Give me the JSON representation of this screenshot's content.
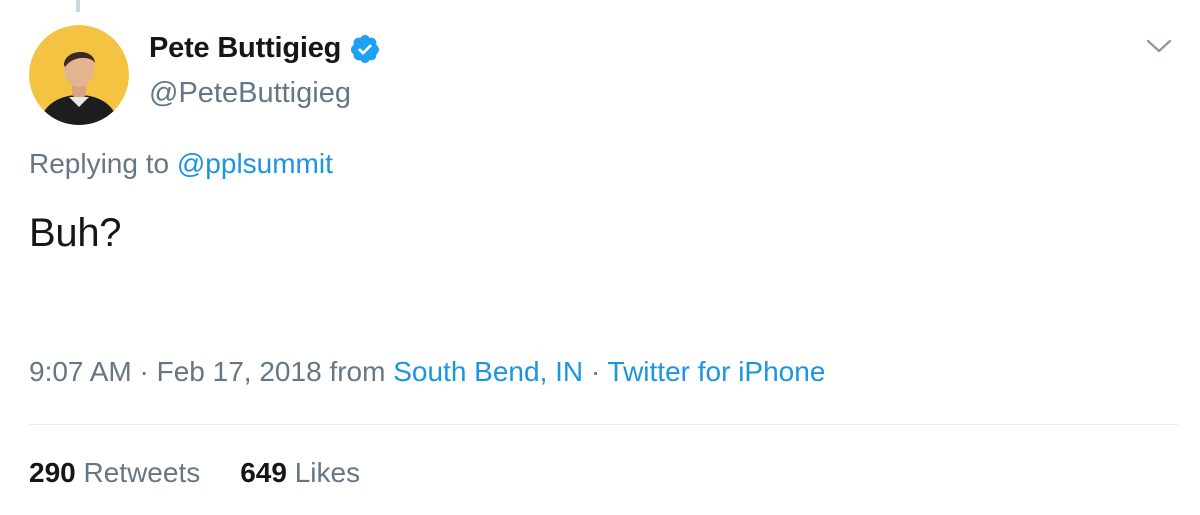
{
  "author": {
    "display_name": "Pete Buttigieg",
    "handle": "@PeteButtigieg",
    "verified": true,
    "avatar_background": "#f5c342"
  },
  "reply": {
    "prefix": "Replying to",
    "mention": "@pplsummit"
  },
  "tweet": {
    "text": "Buh?"
  },
  "meta": {
    "time": "9:07 AM",
    "separator1": "·",
    "date": "Feb 17, 2018",
    "from": "from",
    "location": "South Bend, IN",
    "separator2": "·",
    "source": "Twitter for iPhone"
  },
  "stats": {
    "retweets_count": "290",
    "retweets_label": "Retweets",
    "likes_count": "649",
    "likes_label": "Likes"
  },
  "colors": {
    "link": "#1b95e0",
    "secondary_text": "#657786",
    "primary_text": "#14171a",
    "verified_badge": "#1da1f2"
  },
  "icons": {
    "verified": "verified-badge-icon",
    "menu": "chevron-down-icon"
  }
}
